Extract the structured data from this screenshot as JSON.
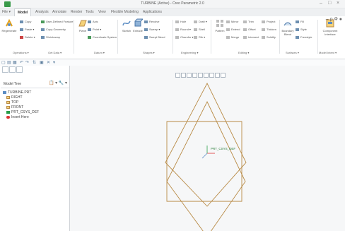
{
  "titlebar": {
    "title": "TURBINE (Active) - Creo Parametric 2.0",
    "controls": [
      "–",
      "□",
      "×"
    ]
  },
  "tabs": [
    "File ▾",
    "Model",
    "Analysis",
    "Annotate",
    "Render",
    "Tools",
    "View",
    "Flexible Modeling",
    "Applications"
  ],
  "active_tab": "Model",
  "ribbon": {
    "regenerate": "Regenerate",
    "copy": "Copy",
    "paste": "Paste ▾",
    "delete": "Delete ▾",
    "user_defined_feature": "User-Defined Feature",
    "copy_geometry": "Copy Geometry",
    "shrinkwrap": "Shrinkwrap",
    "plane": "Plane",
    "axis": "Axis",
    "point": "Point ▾",
    "coordinate_system": "Coordinate System",
    "sketch": "Sketch",
    "extrude": "Extrude",
    "revolve": "Revolve",
    "sweep": "Sweep ▾",
    "swept_blend": "Swept Blend",
    "hole": "Hole",
    "round": "Round ▾",
    "chamfer": "Chamfer ▾",
    "draft": "Draft ▾",
    "shell": "Shell",
    "rib": "Rib ▾",
    "pattern": "Pattern",
    "mirror": "Mirror",
    "trim": "Trim",
    "merge": "Merge",
    "extend": "Extend",
    "offset": "Offset",
    "intersect": "Intersect",
    "project": "Project",
    "thicken": "Thicken",
    "solidify": "Solidify",
    "boundary_blend": "Boundary Blend",
    "fill": "Fill",
    "style": "Style",
    "freestyle": "Freestyle",
    "component_interface": "Component Interface",
    "groups": [
      "Operations ▾",
      "Get Data ▾",
      "Datum ▾",
      "Shapes ▾",
      "Engineering ▾",
      "Editing ▾",
      "Surfaces ▾",
      "Model Intent ▾"
    ],
    "right_icons": "– ρ Ф ●"
  },
  "model_tree": {
    "title": "Model Tree",
    "tools": "📋 ▾ 🔧 ▾",
    "items": [
      "TURBINE.PRT",
      "RIGHT",
      "TOP",
      "FRONT",
      "PRT_CSYS_DEF",
      "Insert Here"
    ]
  },
  "viewport": {
    "csys_label": "PRT_CSYS_DEF"
  },
  "colors": {
    "datum_plane": "#b88a45",
    "csys_red": "#d33",
    "csys_green": "#2a9d4a"
  }
}
